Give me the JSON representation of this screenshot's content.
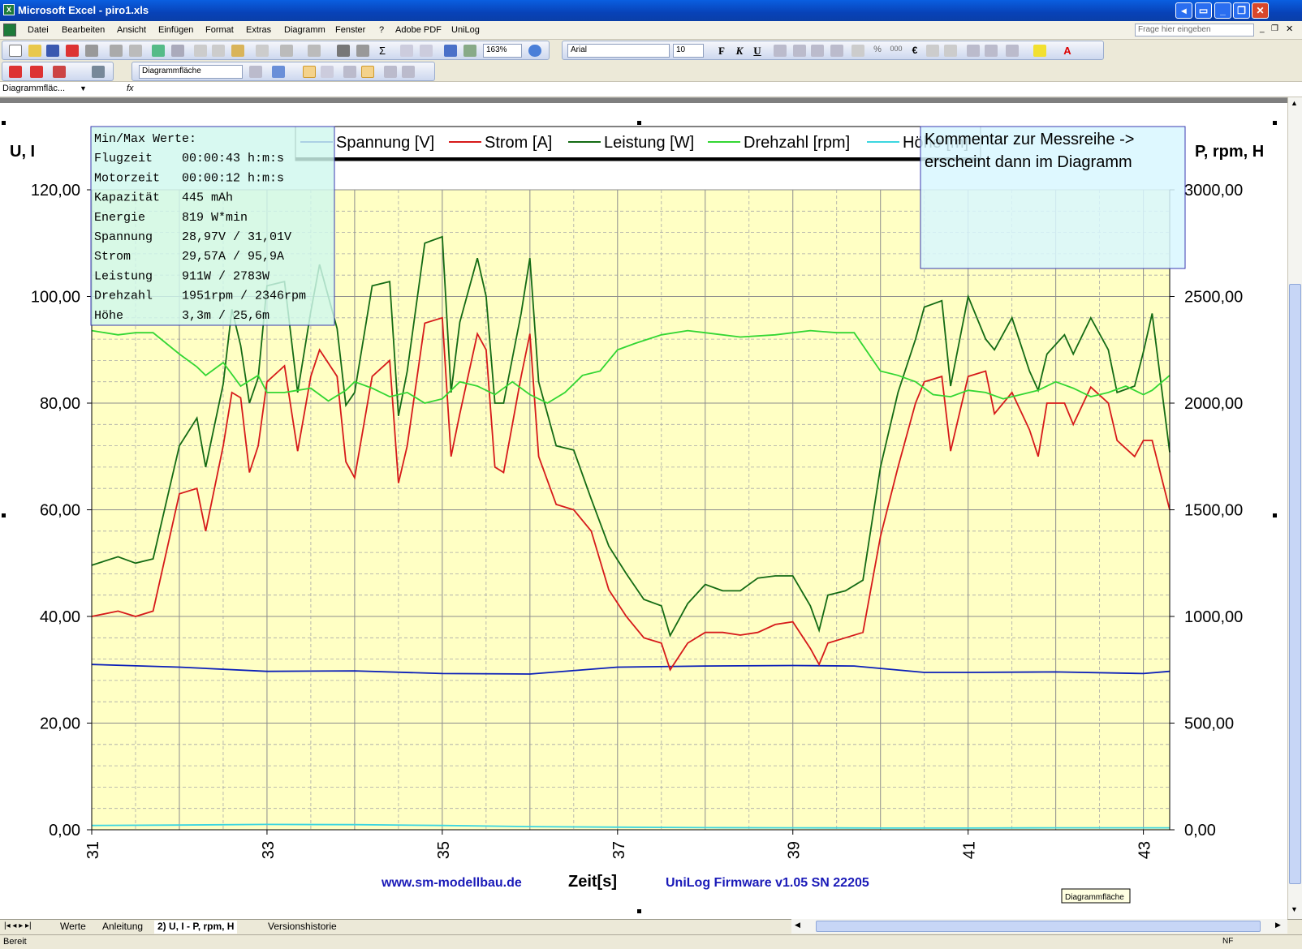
{
  "window": {
    "title": "Microsoft Excel - piro1.xls",
    "icon_glyph": "X"
  },
  "menu": {
    "items": [
      "Datei",
      "Bearbeiten",
      "Ansicht",
      "Einfügen",
      "Format",
      "Extras",
      "Diagramm",
      "Fenster",
      "?",
      "Adobe PDF",
      "UniLog"
    ],
    "help_placeholder": "Frage hier eingeben"
  },
  "toolbar": {
    "zoom": "163%",
    "font": "Arial",
    "font_size": "10",
    "bold": "F",
    "italic": "K",
    "underline": "U",
    "chart_object": "Diagrammfläche",
    "percent": "%",
    "thousands": "000",
    "euro": "€"
  },
  "formula_bar": {
    "name_box": "Diagrammfläc...",
    "fx": "fx",
    "value": ""
  },
  "chart": {
    "left_axis_title": "U, I",
    "right_axis_title": "P, rpm, H",
    "x_axis_title": "Zeit[s]",
    "footer_left": "www.sm-modellbau.de",
    "footer_right": "UniLog Firmware v1.05 SN 22205",
    "tooltip": "Diagrammfläche",
    "comment_box": [
      "Kommentar zur Messreihe ->",
      "erscheint dann im Diagramm"
    ],
    "minmax": [
      "Min/Max Werte:",
      "Flugzeit    00:00:43 h:m:s",
      "Motorzeit   00:00:12 h:m:s",
      "Kapazität   445 mAh",
      "Energie     819 W*min",
      "Spannung    28,97V / 31,01V",
      "Strom       29,57A / 95,9A",
      "Leistung    911W / 2783W",
      "Drehzahl    1951rpm / 2346rpm",
      "Höhe        3,3m / 25,6m"
    ],
    "left_ticks": [
      "0,00",
      "20,00",
      "40,00",
      "60,00",
      "80,00",
      "100,00",
      "120,00"
    ],
    "right_ticks": [
      "0,00",
      "500,00",
      "1000,00",
      "1500,00",
      "2000,00",
      "2500,00",
      "3000,00"
    ],
    "x_ticks": [
      "31",
      "33",
      "35",
      "37",
      "39",
      "41",
      "43"
    ]
  },
  "chart_data": {
    "type": "line",
    "x_unit": "s",
    "xlim": [
      31,
      43.3
    ],
    "ylim_left": [
      0,
      120
    ],
    "ylim_right": [
      0,
      3000
    ],
    "grid": true,
    "legend_position": "top",
    "series": [
      {
        "name": "Spannung [V]",
        "axis": "left",
        "color": "#0b1fb8",
        "x": [
          31,
          32,
          33,
          34,
          35,
          36,
          37,
          38,
          39,
          39.7,
          40.5,
          41,
          42,
          43,
          43.3
        ],
        "y": [
          31,
          30.5,
          29.7,
          29.8,
          29.3,
          29.2,
          30.5,
          30.7,
          30.8,
          30.7,
          29.5,
          29.5,
          29.6,
          29.3,
          29.7
        ]
      },
      {
        "name": "Strom [A]",
        "axis": "left",
        "color": "#d61a1a",
        "x": [
          31,
          31.3,
          31.5,
          31.7,
          32,
          32.2,
          32.3,
          32.5,
          32.6,
          32.7,
          32.8,
          32.9,
          33,
          33.2,
          33.35,
          33.5,
          33.6,
          33.8,
          33.9,
          34,
          34.2,
          34.4,
          34.5,
          34.6,
          34.8,
          35,
          35.1,
          35.2,
          35.4,
          35.5,
          35.6,
          35.7,
          35.9,
          36,
          36.1,
          36.3,
          36.5,
          36.7,
          36.9,
          37.1,
          37.3,
          37.5,
          37.6,
          37.8,
          38,
          38.2,
          38.4,
          38.6,
          38.8,
          39,
          39.2,
          39.3,
          39.4,
          39.6,
          39.8,
          40,
          40.2,
          40.4,
          40.5,
          40.7,
          40.8,
          41,
          41.2,
          41.3,
          41.5,
          41.7,
          41.8,
          41.9,
          42.1,
          42.2,
          42.4,
          42.6,
          42.7,
          42.9,
          43,
          43.1,
          43.3
        ],
        "y": [
          40,
          41,
          40,
          41,
          63,
          64,
          56,
          72,
          82,
          81,
          67,
          72,
          84,
          87,
          71,
          85,
          90,
          85,
          69,
          66,
          85,
          88,
          65,
          72,
          95,
          96,
          70,
          78,
          93,
          90,
          68,
          67,
          85,
          93,
          70,
          61,
          60,
          56,
          45,
          40,
          36,
          35,
          30,
          35,
          37,
          37,
          36.5,
          37,
          38.5,
          39,
          34,
          31,
          35,
          36,
          37,
          55,
          68,
          80,
          84,
          85,
          71,
          85,
          86,
          78,
          82,
          75,
          70,
          80,
          80,
          76,
          83,
          80,
          73,
          70,
          73,
          73,
          60
        ]
      },
      {
        "name": "Leistung [W]",
        "axis": "right",
        "color": "#146b14",
        "x": [
          31,
          31.3,
          31.5,
          31.7,
          32,
          32.2,
          32.3,
          32.5,
          32.6,
          32.7,
          32.8,
          32.9,
          33,
          33.2,
          33.35,
          33.5,
          33.6,
          33.8,
          33.9,
          34,
          34.2,
          34.4,
          34.5,
          34.6,
          34.8,
          35,
          35.1,
          35.2,
          35.4,
          35.5,
          35.6,
          35.7,
          35.9,
          36,
          36.1,
          36.3,
          36.5,
          36.7,
          36.9,
          37.1,
          37.3,
          37.5,
          37.6,
          37.8,
          38,
          38.2,
          38.4,
          38.6,
          38.8,
          39,
          39.2,
          39.3,
          39.4,
          39.6,
          39.8,
          40,
          40.2,
          40.4,
          40.5,
          40.7,
          40.8,
          41,
          41.2,
          41.3,
          41.5,
          41.7,
          41.8,
          41.9,
          42.1,
          42.2,
          42.4,
          42.6,
          42.7,
          42.9,
          43,
          43.1,
          43.3
        ],
        "y": [
          1240,
          1280,
          1250,
          1270,
          1800,
          1930,
          1700,
          2090,
          2440,
          2270,
          2000,
          2120,
          2550,
          2570,
          2050,
          2430,
          2650,
          2350,
          1990,
          2050,
          2550,
          2570,
          1940,
          2150,
          2750,
          2780,
          2050,
          2380,
          2680,
          2500,
          2000,
          2000,
          2420,
          2680,
          2100,
          1800,
          1780,
          1550,
          1330,
          1200,
          1080,
          1050,
          910,
          1060,
          1150,
          1120,
          1120,
          1180,
          1190,
          1190,
          1050,
          935,
          1100,
          1120,
          1170,
          1700,
          2050,
          2300,
          2450,
          2480,
          2080,
          2500,
          2300,
          2250,
          2400,
          2150,
          2060,
          2230,
          2320,
          2230,
          2400,
          2250,
          2050,
          2080,
          2240,
          2420,
          1770
        ]
      },
      {
        "name": "Drehzahl [rpm]",
        "axis": "right",
        "color": "#33d633",
        "x": [
          31,
          31.3,
          31.5,
          31.7,
          32,
          32.2,
          32.3,
          32.5,
          32.7,
          32.9,
          33,
          33.2,
          33.35,
          33.5,
          33.7,
          33.9,
          34,
          34.2,
          34.4,
          34.6,
          34.8,
          35,
          35.2,
          35.4,
          35.6,
          35.8,
          36,
          36.2,
          36.4,
          36.6,
          36.8,
          37,
          37.2,
          37.5,
          37.8,
          38,
          38.4,
          38.8,
          39,
          39.2,
          39.5,
          39.7,
          40,
          40.2,
          40.4,
          40.6,
          40.8,
          41,
          41.2,
          41.4,
          41.6,
          41.8,
          42,
          42.2,
          42.4,
          42.6,
          42.8,
          43,
          43.1,
          43.3
        ],
        "y": [
          2340,
          2320,
          2330,
          2330,
          2230,
          2170,
          2130,
          2190,
          2080,
          2130,
          2050,
          2050,
          2060,
          2070,
          2010,
          2060,
          2100,
          2070,
          2030,
          2050,
          2000,
          2020,
          2100,
          2080,
          2040,
          2100,
          2040,
          2000,
          2050,
          2130,
          2150,
          2250,
          2280,
          2320,
          2340,
          2330,
          2310,
          2320,
          2330,
          2340,
          2330,
          2330,
          2150,
          2130,
          2100,
          2040,
          2030,
          2060,
          2050,
          2020,
          2040,
          2060,
          2100,
          2070,
          2030,
          2050,
          2080,
          2040,
          2060,
          2130
        ]
      },
      {
        "name": "Höhe [m]",
        "axis": "right",
        "color": "#3cd6e0",
        "x": [
          31,
          32,
          33,
          34,
          35,
          36,
          37,
          38,
          39,
          40,
          41,
          42,
          43,
          43.3
        ],
        "y": [
          20,
          22,
          25,
          24,
          20,
          15,
          12,
          10,
          9,
          8,
          8,
          9,
          9,
          9
        ]
      }
    ]
  }
}
